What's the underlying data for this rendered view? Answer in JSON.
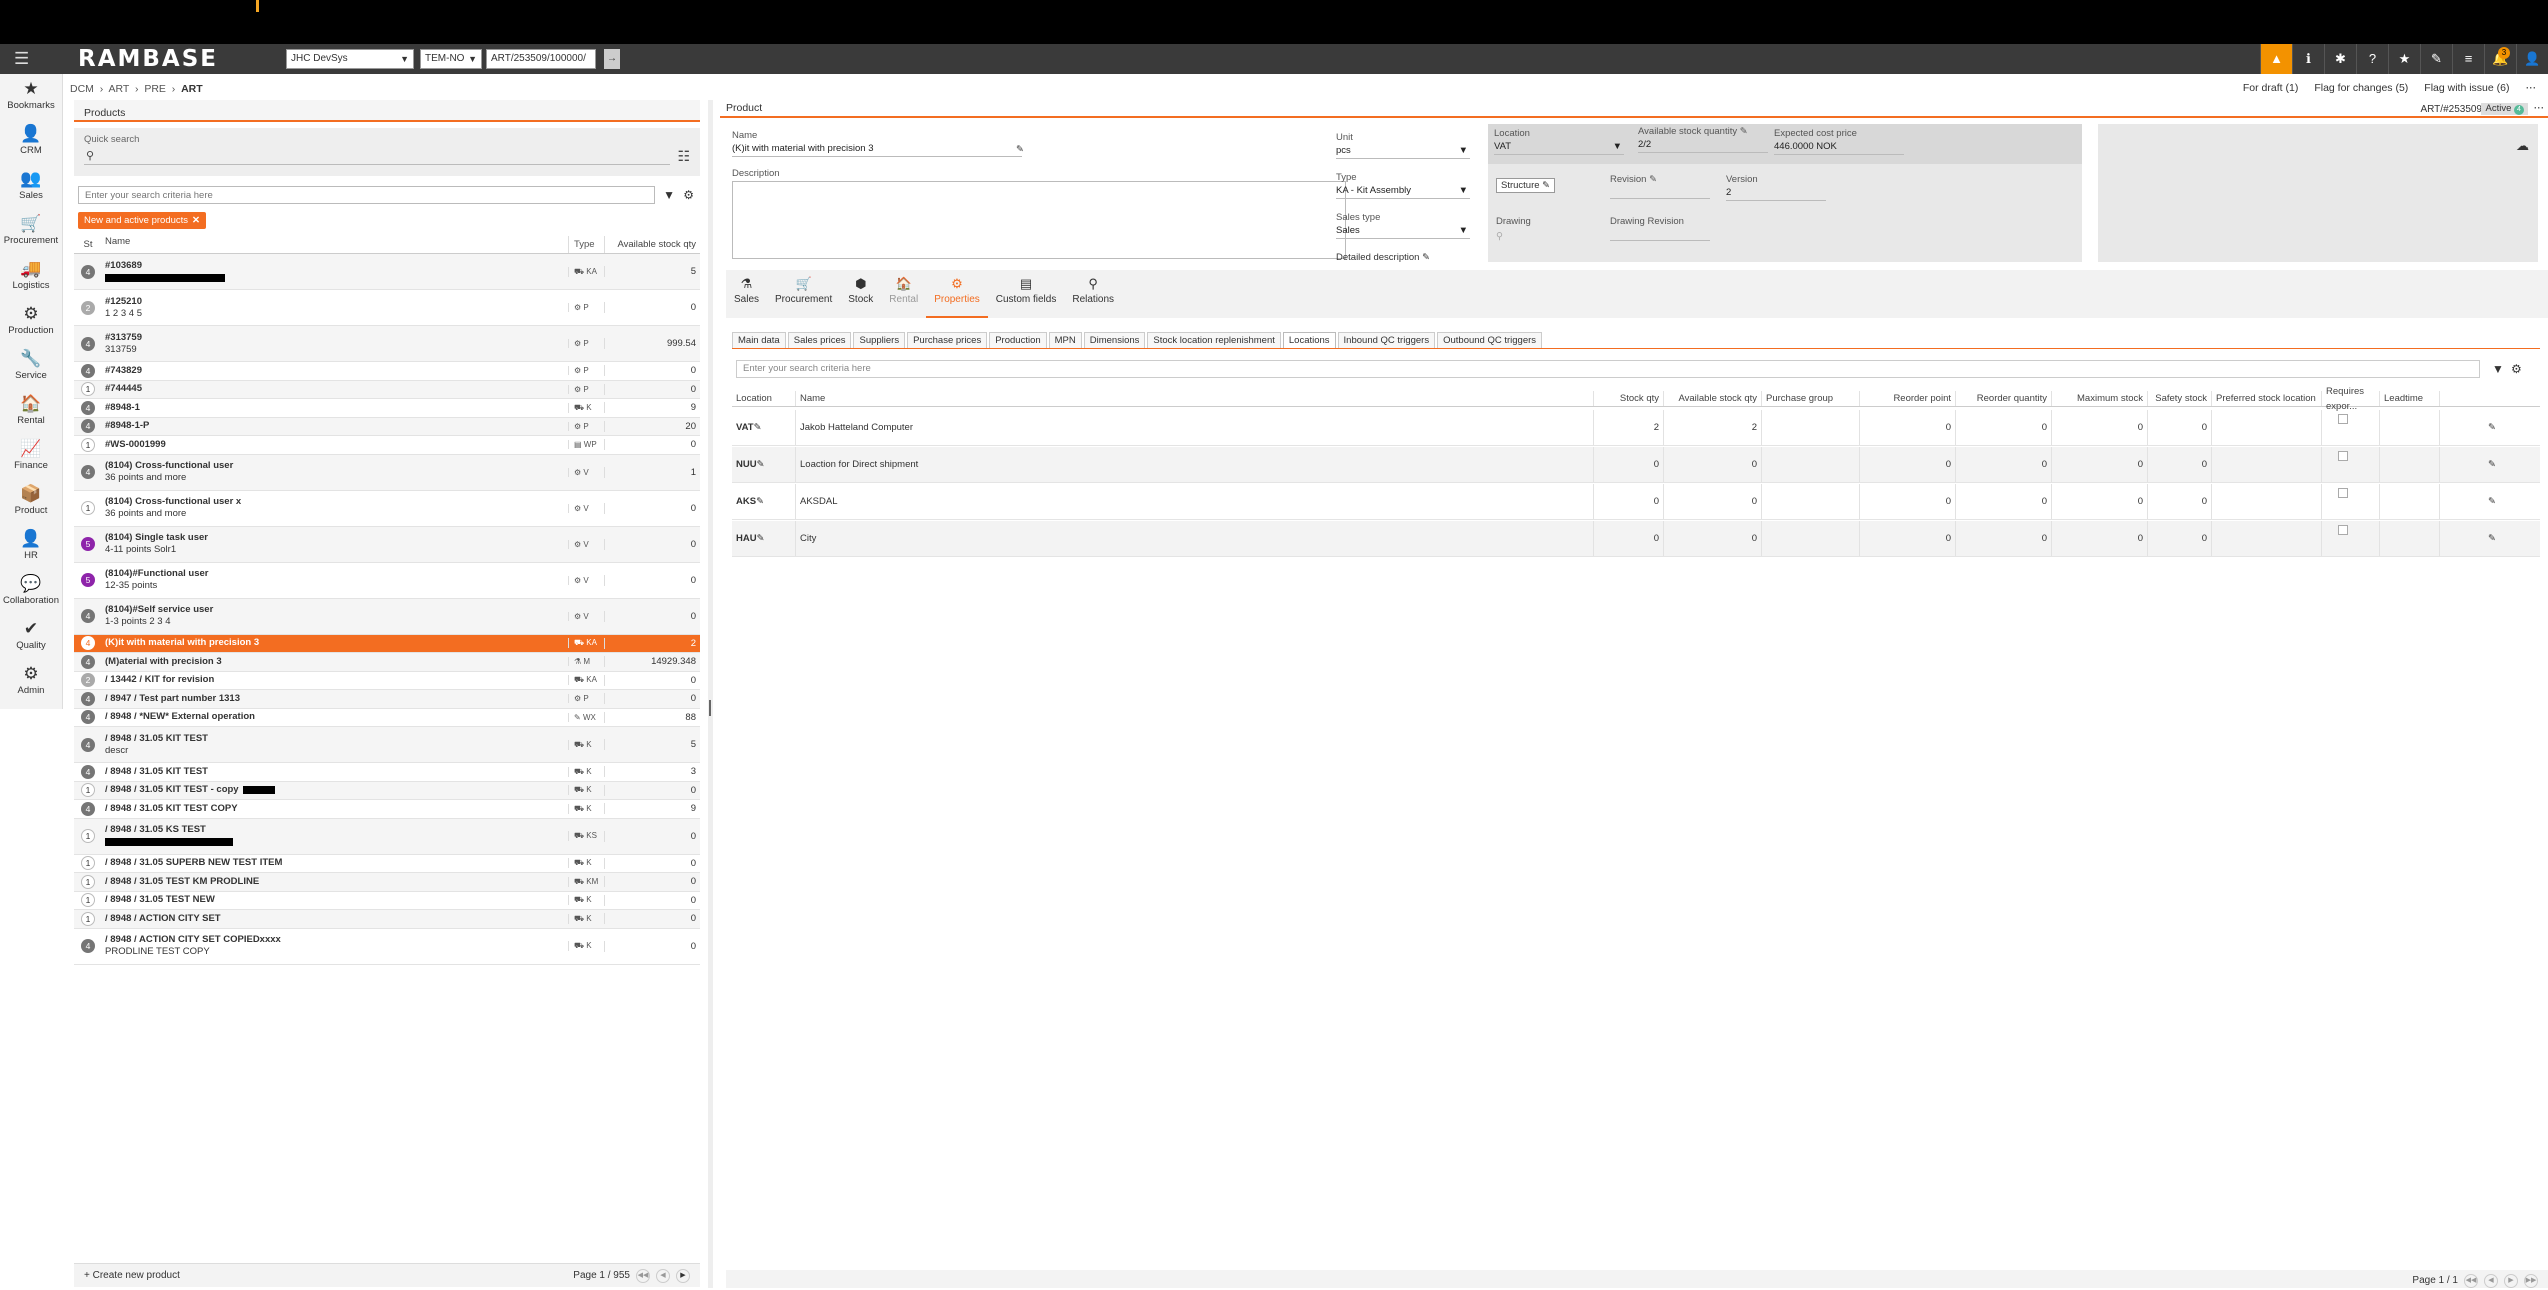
{
  "app": {
    "logo": "RAMBASE",
    "company": "JHC DevSys",
    "system": "TEM-NO",
    "path": "ART/253509/100000/",
    "gobtn": "→"
  },
  "top_icons": [
    "warning-icon",
    "info-icon",
    "settings-icon",
    "help-icon",
    "star-icon",
    "link-icon",
    "list-icon",
    "bell-icon",
    "user-icon"
  ],
  "top_badge": "3",
  "sidebar": [
    {
      "label": "Bookmarks",
      "icon": "★"
    },
    {
      "label": "CRM",
      "icon": "👤"
    },
    {
      "label": "Sales",
      "icon": "👥"
    },
    {
      "label": "Procurement",
      "icon": "🛒"
    },
    {
      "label": "Logistics",
      "icon": "🚚"
    },
    {
      "label": "Production",
      "icon": "⚙"
    },
    {
      "label": "Service",
      "icon": "🔧"
    },
    {
      "label": "Rental",
      "icon": "🏠"
    },
    {
      "label": "Finance",
      "icon": "📈"
    },
    {
      "label": "Product",
      "icon": "📦"
    },
    {
      "label": "HR",
      "icon": "👤"
    },
    {
      "label": "Collaboration",
      "icon": "💬"
    },
    {
      "label": "Quality",
      "icon": "✔"
    },
    {
      "label": "Admin",
      "icon": "⚙"
    }
  ],
  "breadcrumb": [
    "DCM",
    "ART",
    "PRE",
    "ART"
  ],
  "flags": [
    "For draft (1)",
    "Flag for changes (5)",
    "Flag with issue (6)"
  ],
  "left": {
    "title": "Products",
    "quick_search_label": "Quick search",
    "search_placeholder": "Enter your search criteria here",
    "filter_chip": "New and active products",
    "columns": [
      "St",
      "Name",
      "Type",
      "Available stock qty"
    ],
    "rows": [
      {
        "st": "4",
        "name": "#103689",
        "sub": "",
        "redact": 120,
        "type": "KA",
        "qty": "5"
      },
      {
        "st": "2",
        "name": "#125210",
        "sub": "1 2 3 4 5",
        "type": "P",
        "qty": "0"
      },
      {
        "st": "4",
        "name": "#313759",
        "sub": "313759",
        "type": "P",
        "qty": "999.54"
      },
      {
        "st": "4",
        "name": "#743829",
        "sub": "",
        "type": "P",
        "qty": "0"
      },
      {
        "st": "1",
        "name": "#744445",
        "sub": "",
        "type": "P",
        "qty": "0"
      },
      {
        "st": "4",
        "name": "#8948-1",
        "sub": "",
        "type": "K",
        "qty": "9"
      },
      {
        "st": "4",
        "name": "#8948-1-P",
        "sub": "",
        "type": "P",
        "qty": "20"
      },
      {
        "st": "1",
        "name": "#WS-0001999",
        "sub": "",
        "type": "WP",
        "qty": "0"
      },
      {
        "st": "4",
        "name": "(8104) Cross-functional user",
        "sub": "36 points and more",
        "type": "V",
        "qty": "1"
      },
      {
        "st": "1",
        "name": "(8104) Cross-functional user x",
        "sub": "36 points and more",
        "type": "V",
        "qty": "0"
      },
      {
        "st": "5",
        "name": "(8104) Single task user",
        "sub": "4-11 points Solr1",
        "type": "V",
        "qty": "0"
      },
      {
        "st": "5",
        "name": "(8104)#Functional user",
        "sub": "12-35 points",
        "type": "V",
        "qty": "0"
      },
      {
        "st": "4",
        "name": "(8104)#Self service user",
        "sub": "1-3 points 2 3 4",
        "type": "V",
        "qty": "0"
      },
      {
        "st": "4",
        "name": "(K)it with material with precision 3",
        "sub": "",
        "type": "KA",
        "qty": "2",
        "selected": true
      },
      {
        "st": "4",
        "name": "(M)aterial with precision 3",
        "sub": "",
        "type": "M",
        "qty": "14929.348"
      },
      {
        "st": "2",
        "name": "/ 13442 / KIT for revision",
        "sub": "",
        "type": "KA",
        "qty": "0"
      },
      {
        "st": "4",
        "name": "/ 8947 / Test part number 1313",
        "sub": "",
        "type": "P",
        "qty": "0"
      },
      {
        "st": "4",
        "name": "/ 8948 / *NEW* External operation",
        "sub": "",
        "type": "WX",
        "qty": "88"
      },
      {
        "st": "4",
        "name": "/ 8948 / 31.05 KIT TEST",
        "sub": "descr",
        "type": "K",
        "qty": "5"
      },
      {
        "st": "4",
        "name": "/ 8948 / 31.05 KIT TEST",
        "sub": "",
        "type": "K",
        "qty": "3"
      },
      {
        "st": "1",
        "name": "/ 8948 / 31.05 KIT TEST - copy",
        "sub": "",
        "redact_inline": 32,
        "type": "K",
        "qty": "0"
      },
      {
        "st": "4",
        "name": "/ 8948 / 31.05 KIT TEST COPY",
        "sub": "",
        "type": "K",
        "qty": "9"
      },
      {
        "st": "1",
        "name": "/ 8948 / 31.05 KS TEST",
        "sub": "",
        "redact": 128,
        "type": "KS",
        "qty": "0"
      },
      {
        "st": "1",
        "name": "/ 8948 / 31.05 SUPERB NEW TEST ITEM",
        "sub": "",
        "type": "K",
        "qty": "0"
      },
      {
        "st": "1",
        "name": "/ 8948 / 31.05 TEST KM PRODLINE",
        "sub": "",
        "type": "KM",
        "qty": "0"
      },
      {
        "st": "1",
        "name": "/ 8948 / 31.05 TEST NEW",
        "sub": "",
        "type": "K",
        "qty": "0"
      },
      {
        "st": "1",
        "name": "/ 8948 / ACTION CITY SET",
        "sub": "",
        "type": "K",
        "qty": "0"
      },
      {
        "st": "4",
        "name": "/ 8948 / ACTION CITY SET COPIEDxxxx",
        "sub": "PRODLINE TEST COPY",
        "type": "K",
        "qty": "0"
      }
    ],
    "create_label": "Create new product",
    "page_text": "Page 1 / 955"
  },
  "product": {
    "title": "Product",
    "id": "ART/#253509",
    "status": "Active",
    "status_num": "4",
    "name_label": "Name",
    "name_value": "(K)it with material with precision 3",
    "desc_label": "Description",
    "unit_label": "Unit",
    "unit_value": "pcs",
    "type_label": "Type",
    "type_value": "KA - Kit Assembly",
    "sales_type_label": "Sales type",
    "sales_type_value": "Sales",
    "detailed_desc_label": "Detailed description",
    "location_label": "Location",
    "location_value": "VAT",
    "avail_label": "Available stock quantity",
    "avail_value": "2/2",
    "cost_label": "Expected cost price",
    "cost_value": "446.0000 NOK",
    "structure_label": "Structure",
    "revision_label": "Revision",
    "version_label": "Version",
    "version_value": "2",
    "drawing_label": "Drawing",
    "drawing_rev_label": "Drawing Revision"
  },
  "tabs": [
    {
      "label": "Sales",
      "icon": "⚗"
    },
    {
      "label": "Procurement",
      "icon": "🛒"
    },
    {
      "label": "Stock",
      "icon": "⬢"
    },
    {
      "label": "Rental",
      "icon": "🏠",
      "disabled": true
    },
    {
      "label": "Properties",
      "icon": "⚙",
      "active": true
    },
    {
      "label": "Custom fields",
      "icon": "▤"
    },
    {
      "label": "Relations",
      "icon": "⚲"
    }
  ],
  "subtabs": [
    "Main data",
    "Sales prices",
    "Suppliers",
    "Purchase prices",
    "Production",
    "MPN",
    "Dimensions",
    "Stock location replenishment",
    "Locations",
    "Inbound QC triggers",
    "Outbound QC triggers"
  ],
  "subtab_active": "Locations",
  "loc_search_placeholder": "Enter your search criteria here",
  "loc_columns": [
    "Location",
    "Name",
    "Stock qty",
    "Available stock qty",
    "Purchase group",
    "Reorder point",
    "Reorder quantity",
    "Maximum stock",
    "Safety stock",
    "Preferred stock location",
    "Requires expor...",
    "Leadtime"
  ],
  "loc_rows": [
    {
      "loc": "VAT",
      "name": "Jakob Hatteland Computer",
      "stock": "2",
      "avail": "2",
      "pg": "",
      "rp": "0",
      "rq": "0",
      "max": "0",
      "safety": "0"
    },
    {
      "loc": "NUU",
      "name": "Loaction for Direct shipment",
      "stock": "0",
      "avail": "0",
      "pg": "",
      "rp": "0",
      "rq": "0",
      "max": "0",
      "safety": "0"
    },
    {
      "loc": "AKS",
      "name": "AKSDAL",
      "stock": "0",
      "avail": "0",
      "pg": "",
      "rp": "0",
      "rq": "0",
      "max": "0",
      "safety": "0"
    },
    {
      "loc": "HAU",
      "name": "City",
      "stock": "0",
      "avail": "0",
      "pg": "",
      "rp": "0",
      "rq": "0",
      "max": "0",
      "safety": "0"
    }
  ],
  "loc_page": "Page 1 / 1"
}
